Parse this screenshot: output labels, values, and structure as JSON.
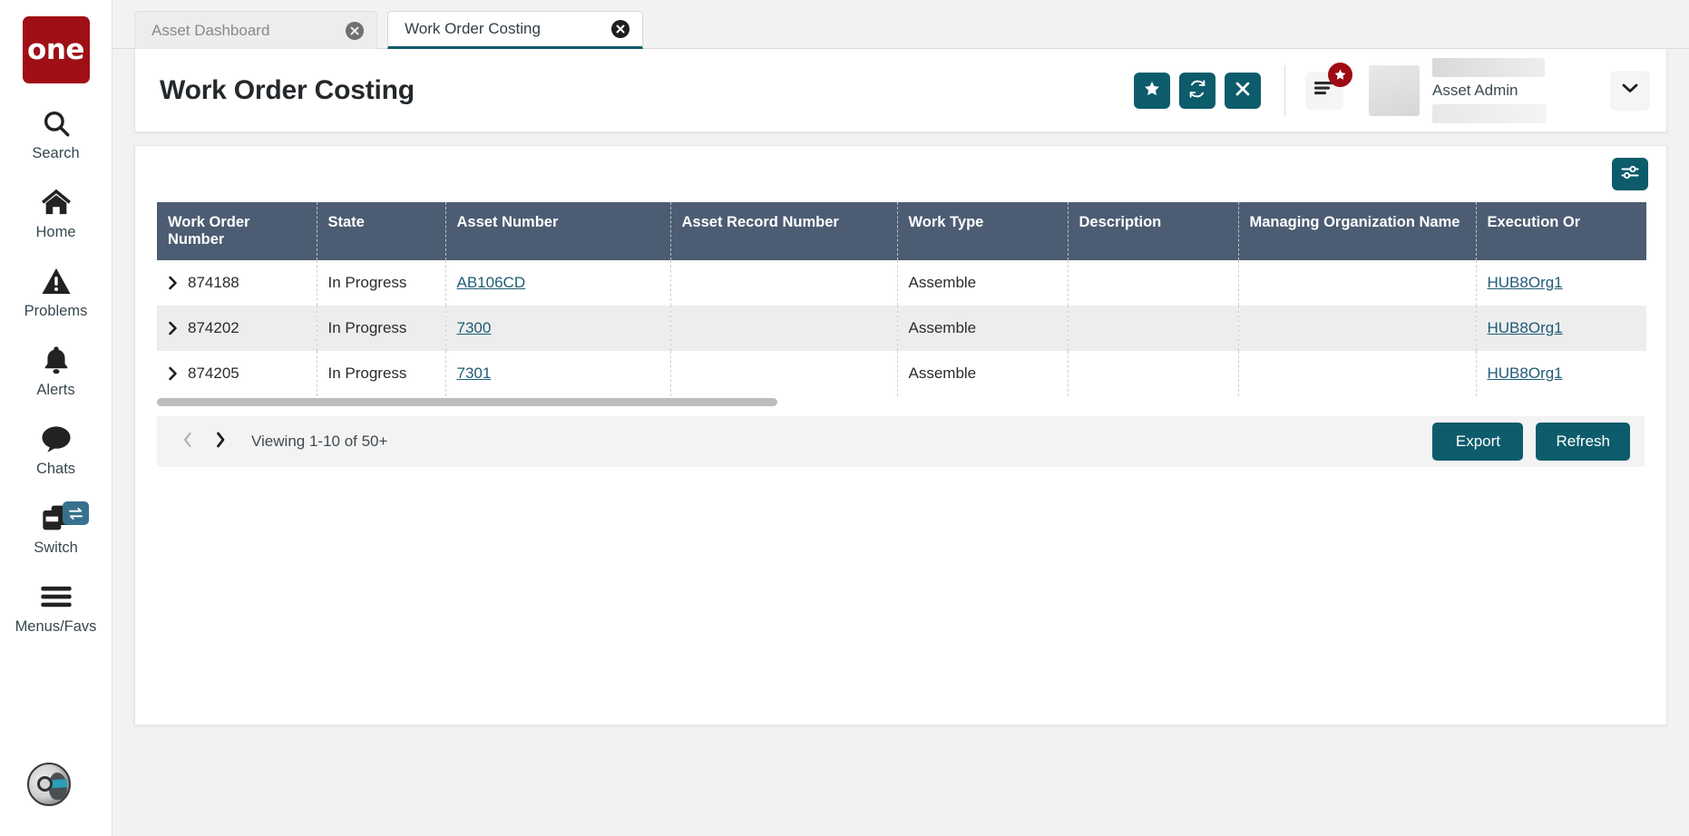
{
  "brand": {
    "logo_text": "one"
  },
  "sidebar": {
    "items": [
      {
        "label": "Search",
        "icon": "search-icon"
      },
      {
        "label": "Home",
        "icon": "home-icon"
      },
      {
        "label": "Problems",
        "icon": "warning-triangle-icon"
      },
      {
        "label": "Alerts",
        "icon": "bell-icon"
      },
      {
        "label": "Chats",
        "icon": "chat-bubble-icon"
      },
      {
        "label": "Switch",
        "icon": "windows-switch-icon",
        "badge_icon": "swap-arrows-icon"
      },
      {
        "label": "Menus/Favs",
        "icon": "hamburger-icon"
      }
    ],
    "avatar": "robot-profile-avatar"
  },
  "tabs": [
    {
      "label": "Asset Dashboard",
      "active": false,
      "close_icon": "close-circle-icon"
    },
    {
      "label": "Work Order Costing",
      "active": true,
      "close_icon": "close-circle-icon"
    }
  ],
  "header": {
    "title": "Work Order Costing",
    "actions": [
      {
        "name": "favorite-button",
        "icon": "star-icon"
      },
      {
        "name": "refresh-page-button",
        "icon": "refresh-icon"
      },
      {
        "name": "close-page-button",
        "icon": "x-icon"
      }
    ],
    "menu_button": {
      "icon": "list-menu-icon",
      "badge_icon": "star-badge-icon"
    },
    "user": {
      "role": "Asset Admin",
      "caret_icon": "chevron-down-icon"
    }
  },
  "grid": {
    "filter_button": {
      "icon": "settings-sliders-icon"
    },
    "columns": [
      "Work Order Number",
      "State",
      "Asset Number",
      "Asset Record Number",
      "Work Type",
      "Description",
      "Managing Organization Name",
      "Execution Or"
    ],
    "rows": [
      {
        "expand_icon": "chevron-right-icon",
        "work_order_number": "874188",
        "state": "In Progress",
        "asset_number": "AB106CD",
        "asset_record_number": "",
        "work_type": "Assemble",
        "description": "",
        "managing_organization_name": "",
        "execution_org": "HUB8Org1"
      },
      {
        "expand_icon": "chevron-right-icon",
        "work_order_number": "874202",
        "state": "In Progress",
        "asset_number": "7300",
        "asset_record_number": "",
        "work_type": "Assemble",
        "description": "",
        "managing_organization_name": "",
        "execution_org": "HUB8Org1"
      },
      {
        "expand_icon": "chevron-right-icon",
        "work_order_number": "874205",
        "state": "In Progress",
        "asset_number": "7301",
        "asset_record_number": "",
        "work_type": "Assemble",
        "description": "",
        "managing_organization_name": "",
        "execution_org": "HUB8Org1"
      }
    ],
    "footer": {
      "prev_icon": "chevron-left-icon",
      "next_icon": "chevron-right-icon",
      "viewing": "Viewing 1-10 of 50+",
      "export_label": "Export",
      "refresh_label": "Refresh"
    }
  },
  "colors": {
    "brand_red": "#a00f16",
    "accent_teal": "#0d5c6b",
    "header_row": "#4c5c72",
    "link": "#1f5c76"
  }
}
